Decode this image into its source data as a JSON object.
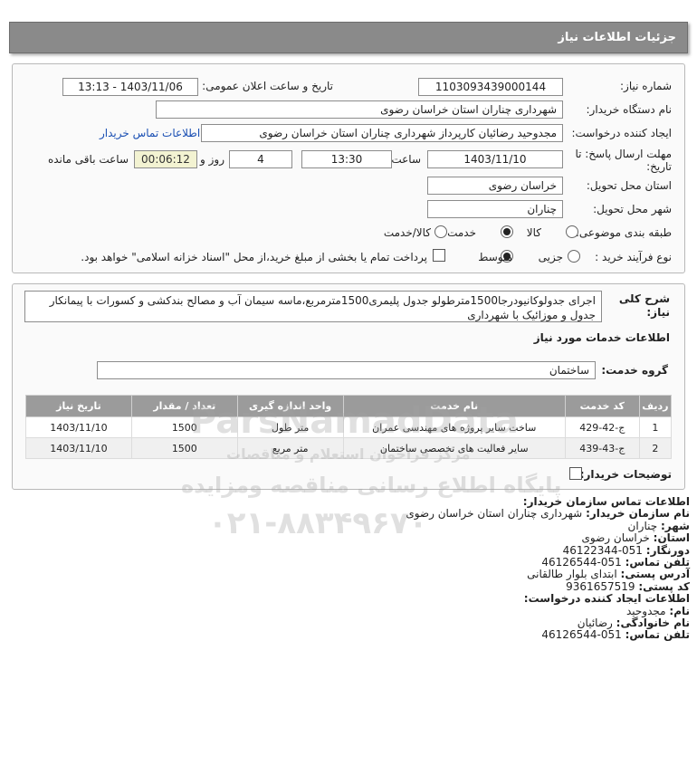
{
  "header": {
    "title": "جزئیات اطلاعات نیاز"
  },
  "form": {
    "need_number_label": "شماره نیاز:",
    "need_number": "1103093439000144",
    "announce_label": "تاریخ و ساعت اعلان عمومی:",
    "announce_value": "1403/11/06 - 13:13",
    "buyer_org_label": "نام دستگاه خریدار:",
    "buyer_org": "شهرداری چناران استان خراسان رضوی",
    "creator_label": "ایجاد کننده درخواست:",
    "creator": "مجدوحید رضائیان کارپرداز شهرداری چناران استان خراسان رضوی",
    "contact_link": "اطلاعات تماس خریدار",
    "deadline_label_1": "مهلت ارسال پاسخ: تا",
    "deadline_label_2": "تاریخ:",
    "deadline_date": "1403/11/10",
    "time_label": "ساعت",
    "deadline_time": "13:30",
    "days_value": "4",
    "days_label": "روز و",
    "remaining_time": "00:06:12",
    "remaining_label": "ساعت باقی مانده",
    "province_label": "استان محل تحویل:",
    "province": "خراسان رضوی",
    "city_label": "شهر محل تحویل:",
    "city": "چناران",
    "category_label": "طبقه بندی موضوعی:",
    "category_options": [
      "کالا",
      "خدمت",
      "کالا/خدمت"
    ],
    "category_selected": "خدمت",
    "process_label": "نوع فرآیند خرید :",
    "process_options": [
      "جزیی",
      "متوسط"
    ],
    "process_selected": "متوسط",
    "payment_note": "پرداخت تمام یا بخشی از مبلغ خرید،از محل \"اسناد خزانه اسلامی\" خواهد بود."
  },
  "description": {
    "label_1": "شرح کلی",
    "label_2": "نیاز:",
    "text": "اجرای جدولوکانیودرجا1500مترطولو جدول پلیمری1500مترمربع،ماسه سیمان آب و مصالح بندکشی و کسورات با پیمانکار جدول و موزائیک با شهرداری"
  },
  "services": {
    "section_title": "اطلاعات خدمات مورد نیاز",
    "group_label": "گروه خدمت:",
    "group_value": "ساختمان",
    "columns": [
      "ردیف",
      "کد خدمت",
      "نام خدمت",
      "واحد اندازه گیری",
      "تعداد / مقدار",
      "تاریخ نیاز"
    ],
    "rows": [
      {
        "idx": "1",
        "code": "ج-42-429",
        "name": "ساخت سایر پروژه های مهندسی عمران",
        "unit": "متر طول",
        "qty": "1500",
        "date": "1403/11/10"
      },
      {
        "idx": "2",
        "code": "ج-43-439",
        "name": "سایر فعالیت های تخصصی ساختمان",
        "unit": "متر مربع",
        "qty": "1500",
        "date": "1403/11/10"
      }
    ],
    "buyer_notes_label": "توضیحات خریدار:"
  },
  "contact": {
    "title": "اطلاعات تماس سازمان خریدار:",
    "org_label": "نام سازمان خریدار:",
    "org": "شهرداری چناران استان خراسان رضوی",
    "city_label": "شهر:",
    "city": "چناران",
    "province_label": "استان:",
    "province": "خراسان رضوی",
    "fax_label": "دورنگار:",
    "fax": "051-46122344",
    "phone_label": "تلفن تماس:",
    "phone": "051-46126544",
    "address_label": "آدرس پستی:",
    "address": "ابتدای بلوار طالقانی",
    "postal_label": "کد پستی:",
    "postal": "9361657519",
    "creator_title": "اطلاعات ایجاد کننده درخواست:",
    "first_name_label": "نام:",
    "first_name": "مجدوحید",
    "last_name_label": "نام خانوادگی:",
    "last_name": "رضائیان",
    "creator_phone_label": "تلفن تماس:",
    "creator_phone": "051-46126544"
  },
  "watermark": {
    "brand": "ParsNamadData",
    "line_1": "مرکز فراخوان استعلام و مناقصات",
    "line_2": "پایگاه اطلاع رسانی مناقصه ومزایده",
    "phone": "۰۲۱-۸۸۳۴۹۶۷۰"
  }
}
